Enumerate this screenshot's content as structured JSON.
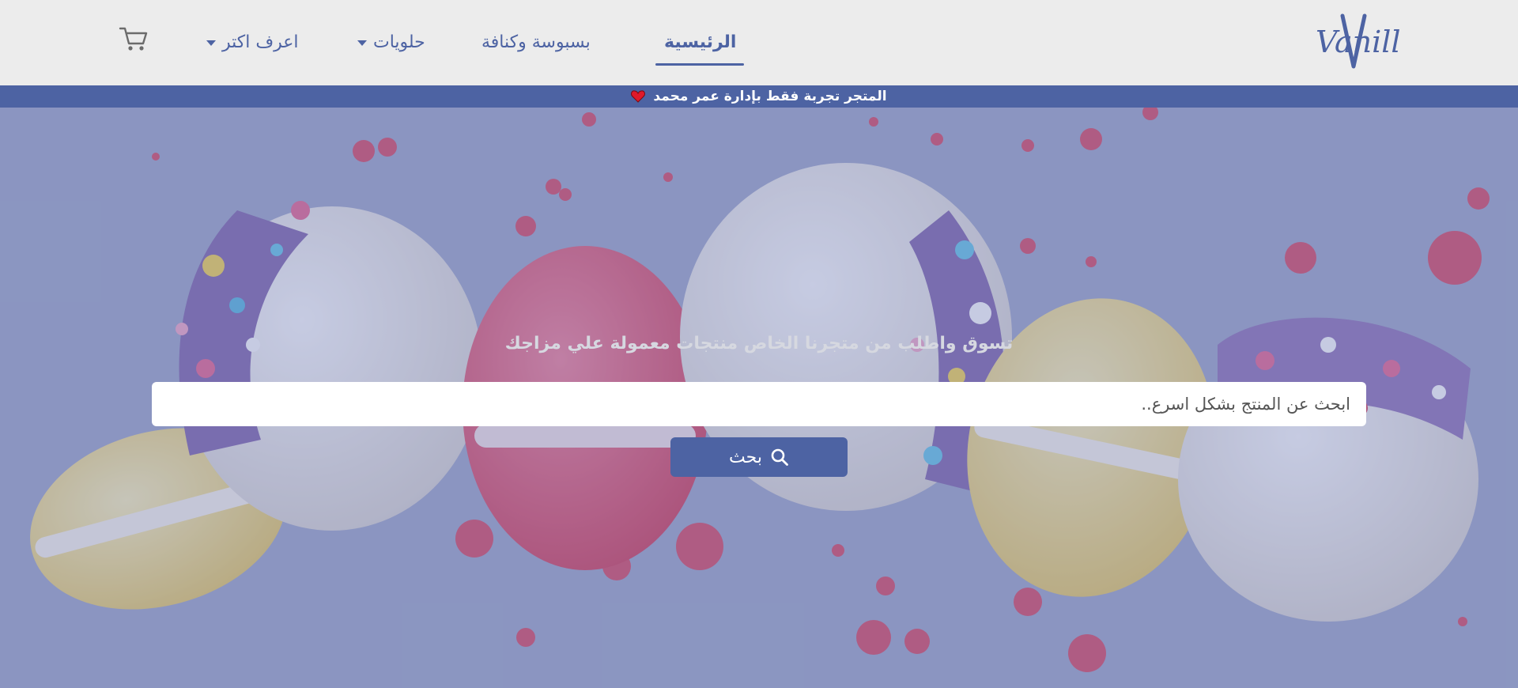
{
  "brand": {
    "logo_text": "Vanilla"
  },
  "nav": {
    "items": [
      {
        "label": "الرئيسية",
        "active": true
      },
      {
        "label": "بسبوسة وكنافة",
        "active": false
      },
      {
        "label": "حلويات",
        "active": false,
        "dropdown": true
      },
      {
        "label": "اعرف اكتر",
        "active": false,
        "dropdown": true
      }
    ],
    "cart_icon": "shopping-cart-icon"
  },
  "announcement": {
    "text": "المتجر تجربة فقط بإدارة عمر محمد",
    "icon": "heart-icon"
  },
  "hero": {
    "tagline": "تسوق واطلب من متجرنا الخاص منتجات معمولة علي مزاجك",
    "search": {
      "placeholder": "ابحث عن المنتج بشكل اسرع..",
      "value": ""
    },
    "search_button": {
      "label": "بحث",
      "icon": "search-icon"
    },
    "background": "macarons-image"
  },
  "colors": {
    "primary": "#4d63a3",
    "header_bg": "#ececec",
    "hero_overlay": "#7684ba"
  }
}
